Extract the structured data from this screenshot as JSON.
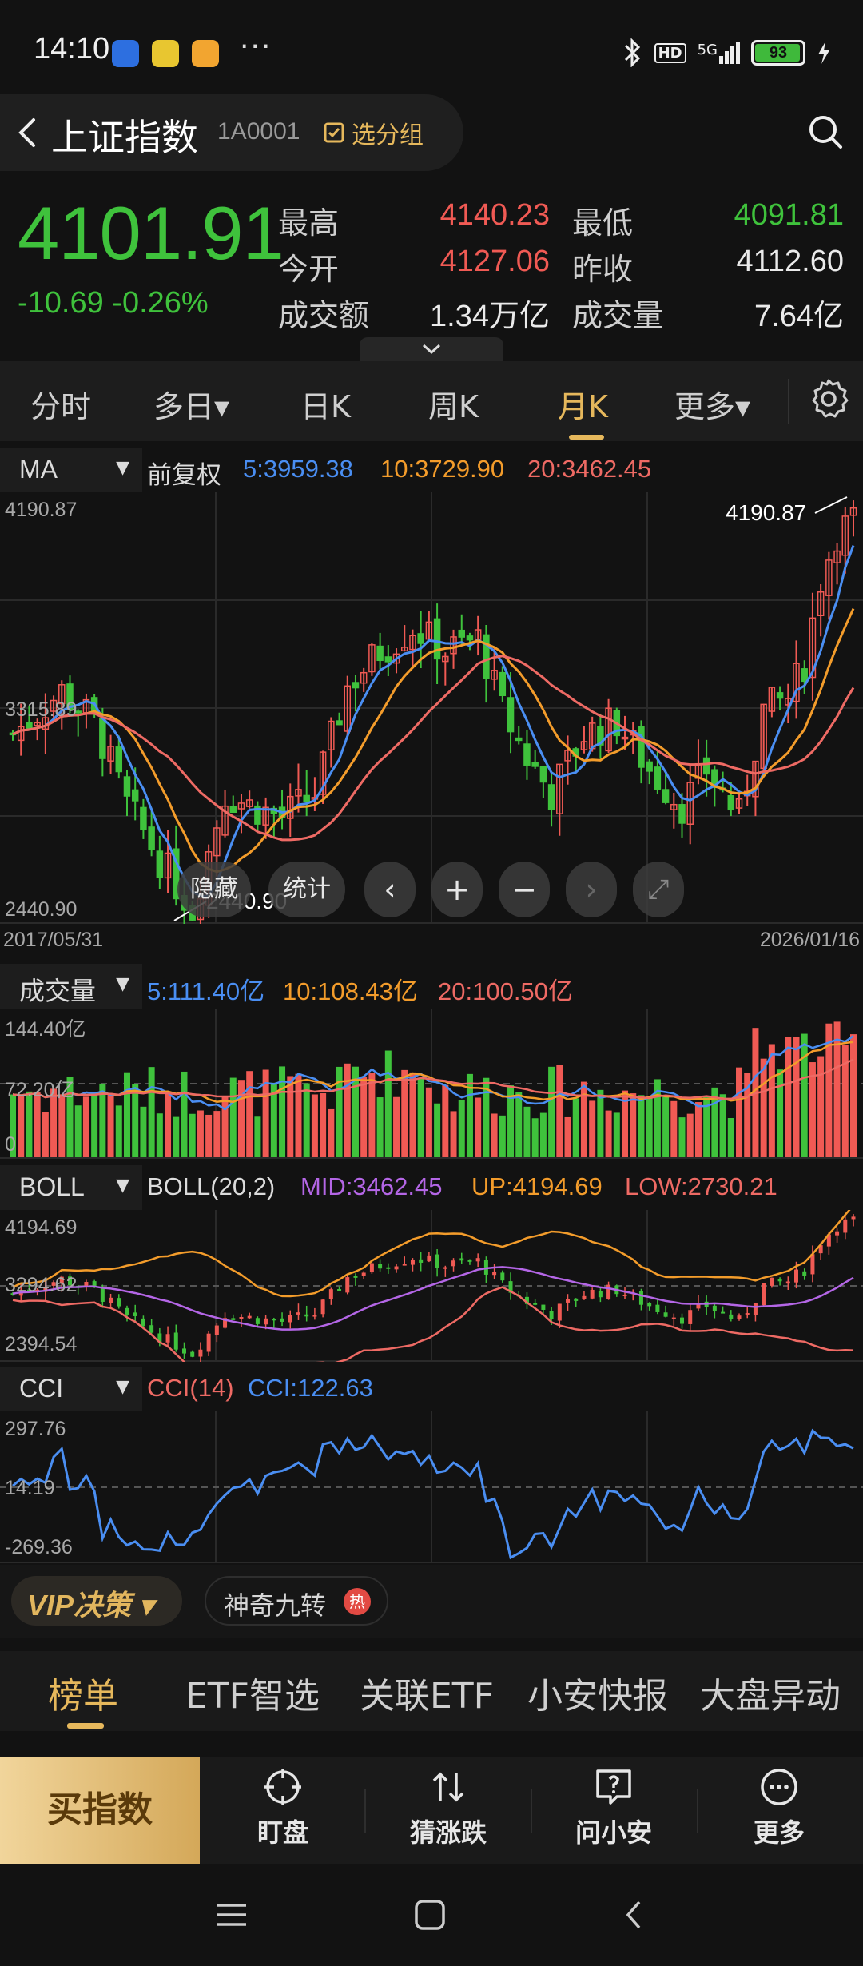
{
  "status_bar": {
    "time": "14:10",
    "dots": "···",
    "network": "5G",
    "hd": "HD",
    "battery": "93",
    "battery_level": 0.93
  },
  "header": {
    "title": "上证指数",
    "code": "1A0001",
    "group_button": "选分组"
  },
  "quote": {
    "price": "4101.91",
    "change": "-10.69  -0.26%",
    "stats": [
      {
        "label": "最高",
        "value": "4140.23",
        "color": "red"
      },
      {
        "label": "最低",
        "value": "4091.81",
        "color": "green"
      },
      {
        "label": "今开",
        "value": "4127.06",
        "color": "red"
      },
      {
        "label": "昨收",
        "value": "4112.60",
        "color": "white"
      },
      {
        "label": "成交额",
        "value": "1.34万亿",
        "color": "white"
      },
      {
        "label": "成交量",
        "value": "7.64亿",
        "color": "white"
      }
    ]
  },
  "period_tabs": [
    "分时",
    "多日▾",
    "日K",
    "周K",
    "月K",
    "更多▾"
  ],
  "active_period": "月K",
  "main_chart": {
    "indicator": "MA",
    "adjust": "前复权",
    "ma5": "5:3959.38",
    "ma10": "10:3729.90",
    "ma20": "20:3462.45",
    "y_top": "4190.87",
    "y_mid": "3315.89",
    "y_bottom": "2440.90",
    "high_label": "4190.87",
    "low_label": "2440.90",
    "start_date": "2017/05/31",
    "end_date": "2026/01/16",
    "controls": {
      "hide": "隐藏",
      "stats": "统计",
      "prev": "‹",
      "zoom_in": "+",
      "zoom_out": "−",
      "next": "›",
      "fullscreen": "⤢"
    }
  },
  "volume_panel": {
    "indicator": "成交量",
    "ma5": "5:111.40亿",
    "ma10": "10:108.43亿",
    "ma20": "20:100.50亿",
    "y_top": "144.40亿",
    "y_mid": "72.20亿",
    "y_bottom": "0"
  },
  "boll_panel": {
    "indicator": "BOLL",
    "params": "BOLL(20,2)",
    "mid": "MID:3462.45",
    "up": "UP:4194.69",
    "low": "LOW:2730.21",
    "y_top": "4194.69",
    "y_mid": "3294.62",
    "y_bottom": "2394.54"
  },
  "cci_panel": {
    "indicator": "CCI",
    "params": "CCI(14)",
    "value": "CCI:122.63",
    "y_top": "297.76",
    "y_mid": "14.19",
    "y_bottom": "-269.36"
  },
  "feature_row": {
    "vip": "VIP决策 ▾",
    "magic": "神奇九转",
    "hot": "热"
  },
  "bottom_tabs": [
    "榜单",
    "ETF智选",
    "关联ETF",
    "小安快报",
    "大盘异动"
  ],
  "actions": {
    "buy": "买指数",
    "watch": "盯盘",
    "guess": "猜涨跌",
    "ask": "问小安",
    "more": "更多"
  },
  "colors": {
    "up": "#f05a54",
    "down": "#3fc23c",
    "accent": "#e6b85c",
    "ma5": "#4a8ef2",
    "ma10": "#f39c2b",
    "ma20": "#ee6a64"
  }
}
